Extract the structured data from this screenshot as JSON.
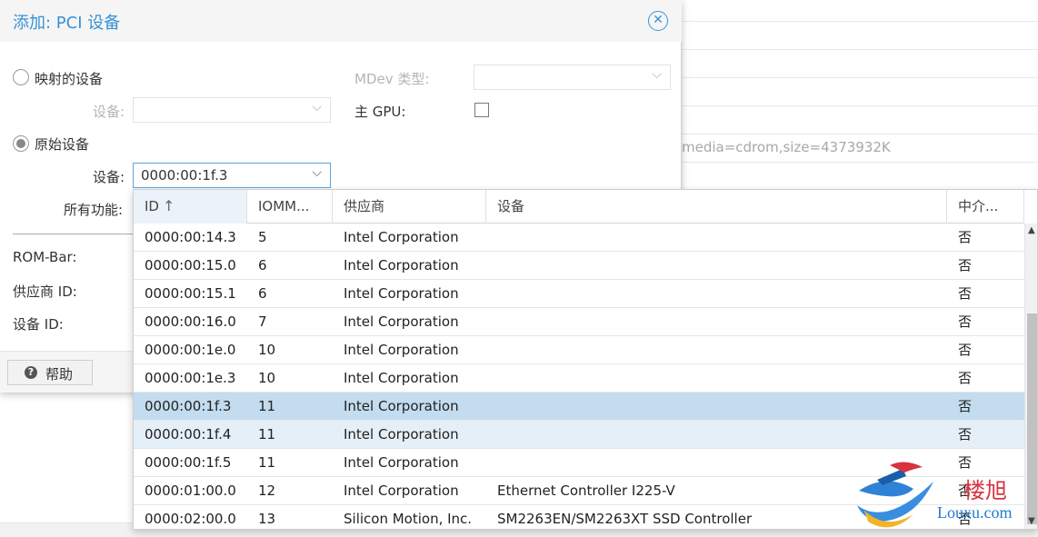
{
  "background": {
    "cdrom_text": "media=cdrom,size=4373932K"
  },
  "dialog": {
    "title": "添加: PCI 设备",
    "close_icon": "close-circle-icon",
    "mapped_device_label": "映射的设备",
    "mapped_device_field_label": "设备:",
    "mdev_type_label": "MDev 类型:",
    "primary_gpu_label": "主 GPU:",
    "raw_device_label": "原始设备",
    "raw_device_field_label": "设备:",
    "raw_device_value": "0000:00:1f.3",
    "all_functions_label": "所有功能:",
    "rombar_label": "ROM-Bar:",
    "vendor_id_label": "供应商 ID:",
    "device_id_label": "设备 ID:",
    "help_button_label": "帮助",
    "help_icon": "question-circle-icon"
  },
  "grid": {
    "columns": [
      "ID",
      "IOMM...",
      "供应商",
      "设备",
      "中介..."
    ],
    "sort_icon": "arrow-up-icon",
    "rows": [
      {
        "id": "0000:00:14.3",
        "iommu": "5",
        "vendor": "Intel Corporation",
        "device": "",
        "mediated": "否",
        "state": ""
      },
      {
        "id": "0000:00:15.0",
        "iommu": "6",
        "vendor": "Intel Corporation",
        "device": "",
        "mediated": "否",
        "state": ""
      },
      {
        "id": "0000:00:15.1",
        "iommu": "6",
        "vendor": "Intel Corporation",
        "device": "",
        "mediated": "否",
        "state": ""
      },
      {
        "id": "0000:00:16.0",
        "iommu": "7",
        "vendor": "Intel Corporation",
        "device": "",
        "mediated": "否",
        "state": ""
      },
      {
        "id": "0000:00:1e.0",
        "iommu": "10",
        "vendor": "Intel Corporation",
        "device": "",
        "mediated": "否",
        "state": ""
      },
      {
        "id": "0000:00:1e.3",
        "iommu": "10",
        "vendor": "Intel Corporation",
        "device": "",
        "mediated": "否",
        "state": ""
      },
      {
        "id": "0000:00:1f.3",
        "iommu": "11",
        "vendor": "Intel Corporation",
        "device": "",
        "mediated": "否",
        "state": "selected"
      },
      {
        "id": "0000:00:1f.4",
        "iommu": "11",
        "vendor": "Intel Corporation",
        "device": "",
        "mediated": "否",
        "state": "hover"
      },
      {
        "id": "0000:00:1f.5",
        "iommu": "11",
        "vendor": "Intel Corporation",
        "device": "",
        "mediated": "否",
        "state": ""
      },
      {
        "id": "0000:01:00.0",
        "iommu": "12",
        "vendor": "Intel Corporation",
        "device": "Ethernet Controller I225-V",
        "mediated": "否",
        "state": ""
      },
      {
        "id": "0000:02:00.0",
        "iommu": "13",
        "vendor": "Silicon Motion, Inc.",
        "device": "SM2263EN/SM2263XT SSD Controller",
        "mediated": "否",
        "state": ""
      }
    ]
  },
  "watermark": {
    "cn": "楼旭",
    "en": "Louxu.com"
  },
  "colors": {
    "accent": "#3892d4",
    "selected_row": "#c3dcef",
    "hover_row": "#e4eff8"
  }
}
